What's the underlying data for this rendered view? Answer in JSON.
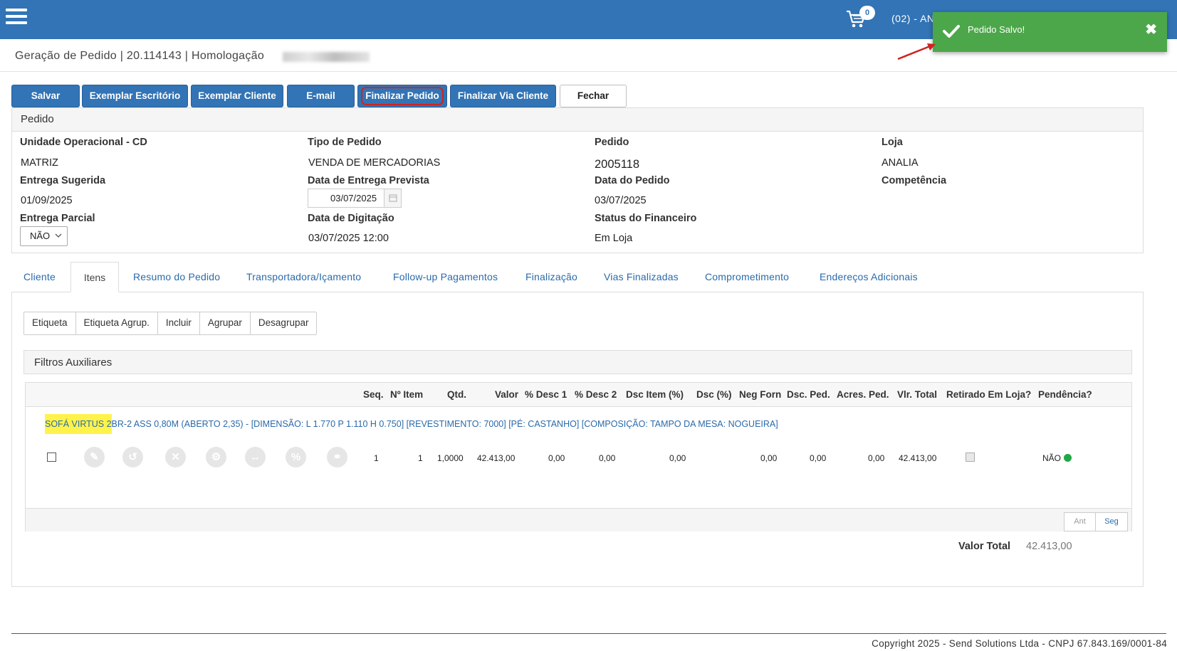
{
  "header": {
    "cart_count": "0",
    "user_label": "(02) - AN"
  },
  "page": {
    "title": "Geração de Pedido | 20.114143 | Homologação"
  },
  "toast": {
    "message": "Pedido Salvo!"
  },
  "toolbar": {
    "salvar": "Salvar",
    "exemplar_escritorio": "Exemplar Escritório",
    "exemplar_cliente": "Exemplar Cliente",
    "email": "E-mail",
    "finalizar_pedido": "Finalizar Pedido",
    "finalizar_via_cliente": "Finalizar Via Cliente",
    "fechar": "Fechar"
  },
  "pedido": {
    "panel_title": "Pedido",
    "unidade_label": "Unidade Operacional - CD",
    "unidade_value": "MATRIZ",
    "tipo_label": "Tipo de Pedido",
    "tipo_value": "VENDA DE MERCADORIAS",
    "pedido_label": "Pedido",
    "pedido_value": "2005118",
    "loja_label": "Loja",
    "loja_value": "ANALIA",
    "entrega_sugerida_label": "Entrega Sugerida",
    "entrega_sugerida_value": "01/09/2025",
    "data_entrega_prevista_label": "Data de Entrega Prevista",
    "data_entrega_prevista_value": "03/07/2025",
    "data_pedido_label": "Data do Pedido",
    "data_pedido_value": "03/07/2025",
    "competencia_label": "Competência",
    "entrega_parcial_label": "Entrega Parcial",
    "entrega_parcial_value": "NÃO",
    "data_digitacao_label": "Data de Digitação",
    "data_digitacao_value": "03/07/2025 12:00",
    "status_financeiro_label": "Status do Financeiro",
    "status_financeiro_value": "Em Loja"
  },
  "tabs": {
    "cliente": "Cliente",
    "itens": "Itens",
    "resumo": "Resumo do Pedido",
    "transportadora": "Transportadora/Içamento",
    "followup": "Follow-up Pagamentos",
    "finalizacao": "Finalização",
    "vias": "Vias Finalizadas",
    "comprometimento": "Comprometimento",
    "enderecos": "Endereços Adicionais"
  },
  "itens_toolbar": {
    "etiqueta": "Etiqueta",
    "etiqueta_agrup": "Etiqueta Agrup.",
    "incluir": "Incluir",
    "agrupar": "Agrupar",
    "desagrupar": "Desagrupar"
  },
  "filtros": {
    "title": "Filtros Auxiliares"
  },
  "grid": {
    "headers": {
      "seq": "Seq.",
      "n_item": "Nº Item",
      "qtd": "Qtd.",
      "valor": "Valor",
      "desc1": "% Desc 1",
      "desc2": "% Desc 2",
      "dsc_item": "Dsc Item (%)",
      "dsc": "Dsc (%)",
      "neg_forn": "Neg Forn",
      "dsc_ped": "Dsc. Ped.",
      "acres_ped": "Acres. Ped.",
      "vlr_total": "Vlr. Total",
      "retirado": "Retirado Em Loja?",
      "pendencia": "Pendência?"
    },
    "product_highlight": "SOFÁ VIRTUS 2",
    "product_rest": "BR-2 ASS 0,80M (ABERTO 2,35) - [DIMENSÃO: L 1.770 P 1.110 H 0.750] [REVESTIMENTO: 7000] [PÉ: CASTANHO] [COMPOSIÇÃO: TAMPO DA MESA: NOGUEIRA]",
    "row": {
      "seq": "1",
      "n_item": "1",
      "qtd": "1,0000",
      "valor": "42.413,00",
      "desc1": "0,00",
      "desc2": "0,00",
      "dsc_item": "0,00",
      "neg_forn": "0,00",
      "dsc_ped": "0,00",
      "acres_ped": "0,00",
      "vlr_total": "42.413,00",
      "pendencia": "NÃO"
    },
    "pager": {
      "ant": "Ant",
      "seg": "Seg"
    }
  },
  "totals": {
    "label": "Valor Total",
    "value": "42.413,00"
  },
  "footer": {
    "copyright": "Copyright 2025 - Send Solutions Ltda - CNPJ 67.843.169/0001-84"
  },
  "colors": {
    "primary": "#3274b5",
    "toast_green": "#4ca74a",
    "highlight_yellow": "#fff34a",
    "pending_green": "#1fa845",
    "annotation_red": "#d0231e"
  }
}
